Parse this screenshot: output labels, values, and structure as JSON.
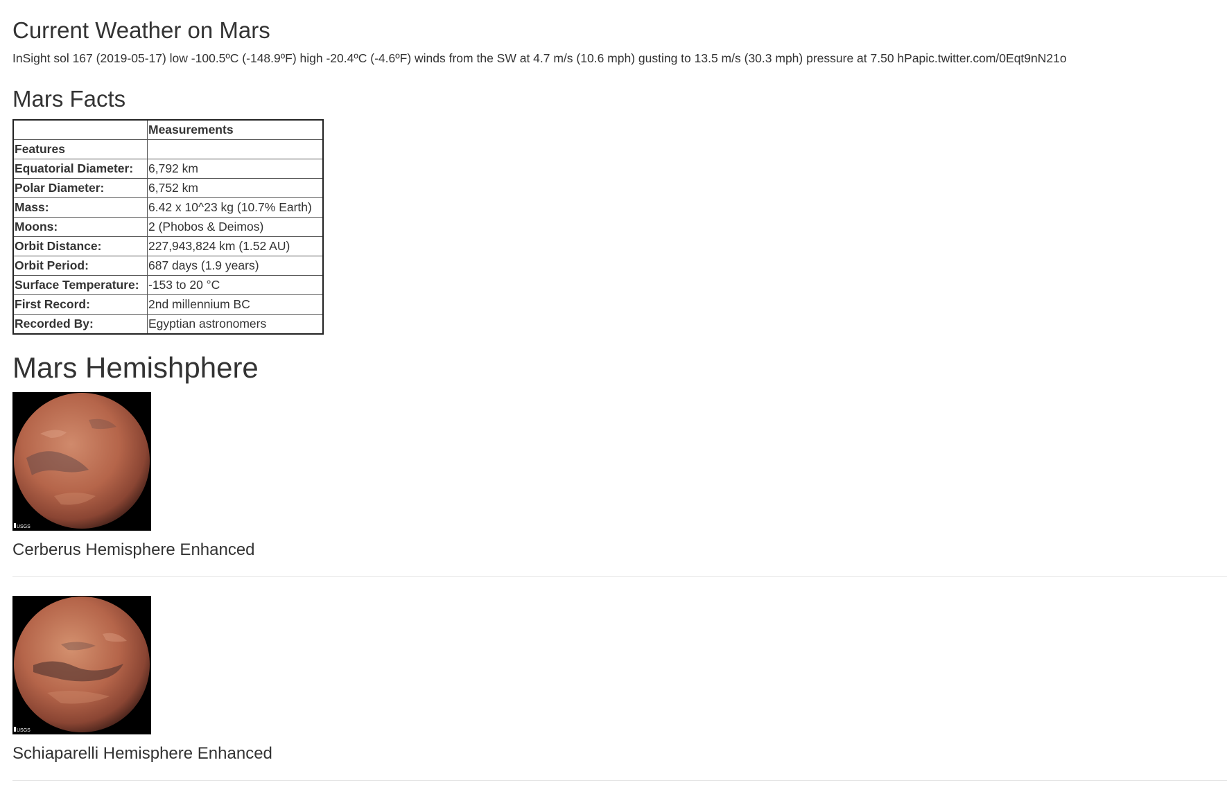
{
  "weather": {
    "title": "Current Weather on Mars",
    "text": "InSight sol 167 (2019-05-17) low -100.5ºC (-148.9ºF) high -20.4ºC (-4.6ºF) winds from the SW at 4.7 m/s (10.6 mph) gusting to 13.5 m/s (30.3 mph) pressure at 7.50 hPapic.twitter.com/0Eqt9nN21o"
  },
  "facts": {
    "title": "Mars Facts",
    "header": [
      "",
      "Measurements"
    ],
    "index_label": "Features",
    "rows": [
      {
        "label": "Equatorial Diameter:",
        "value": "6,792 km"
      },
      {
        "label": "Polar Diameter:",
        "value": "6,752 km"
      },
      {
        "label": "Mass:",
        "value": "6.42 x 10^23 kg (10.7% Earth)"
      },
      {
        "label": "Moons:",
        "value": "2 (Phobos & Deimos)"
      },
      {
        "label": "Orbit Distance:",
        "value": "227,943,824 km (1.52 AU)"
      },
      {
        "label": "Orbit Period:",
        "value": "687 days (1.9 years)"
      },
      {
        "label": "Surface Temperature:",
        "value": "-153 to 20 °C"
      },
      {
        "label": "First Record:",
        "value": "2nd millennium BC"
      },
      {
        "label": "Recorded By:",
        "value": "Egyptian astronomers"
      }
    ]
  },
  "hemispheres": {
    "title": "Mars Hemishphere",
    "items": [
      {
        "caption": "Cerberus Hemisphere Enhanced",
        "logo_text": "USGS"
      },
      {
        "caption": "Schiaparelli Hemisphere Enhanced",
        "logo_text": "USGS"
      }
    ]
  },
  "colors": {
    "text": "#333333",
    "mars_base": "#b5654a",
    "mars_dark": "#5e3a33",
    "image_bg": "#000000",
    "divider": "#e5e5e5"
  }
}
